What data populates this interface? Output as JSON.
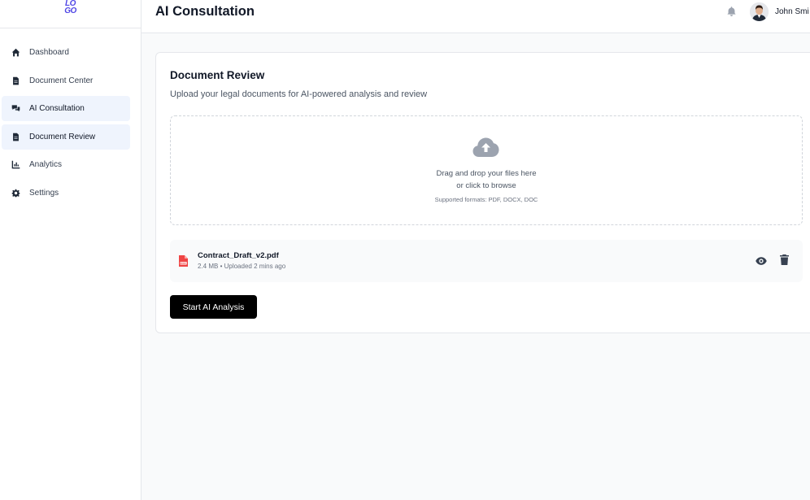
{
  "logo": {
    "line1": "LO",
    "line2": "GO"
  },
  "sidebar": {
    "items": [
      {
        "label": "Dashboard",
        "icon": "home-icon",
        "active": false
      },
      {
        "label": "Document Center",
        "icon": "file-icon",
        "active": false
      },
      {
        "label": "AI Consultation",
        "icon": "comments-icon",
        "active": true
      },
      {
        "label": "Document Review",
        "icon": "file-text-icon",
        "active": true
      },
      {
        "label": "Analytics",
        "icon": "chart-icon",
        "active": false
      },
      {
        "label": "Settings",
        "icon": "gear-icon",
        "active": false
      }
    ]
  },
  "header": {
    "title": "AI Consultation",
    "user_name": "John Smi"
  },
  "card": {
    "title": "Document Review",
    "subtitle": "Upload your legal documents for AI-powered analysis and review",
    "dropzone": {
      "line1": "Drag and drop your files here",
      "line2": "or click to browse",
      "formats": "Supported formats: PDF, DOCX, DOC"
    },
    "file": {
      "name": "Contract_Draft_v2.pdf",
      "meta": "2.4 MB • Uploaded 2 mins ago"
    },
    "analyze_label": "Start AI Analysis"
  },
  "colors": {
    "accent": "#4f46e5",
    "active_bg": "#eff4fd",
    "pdf_red": "#ef4444",
    "button_bg": "#000000"
  }
}
